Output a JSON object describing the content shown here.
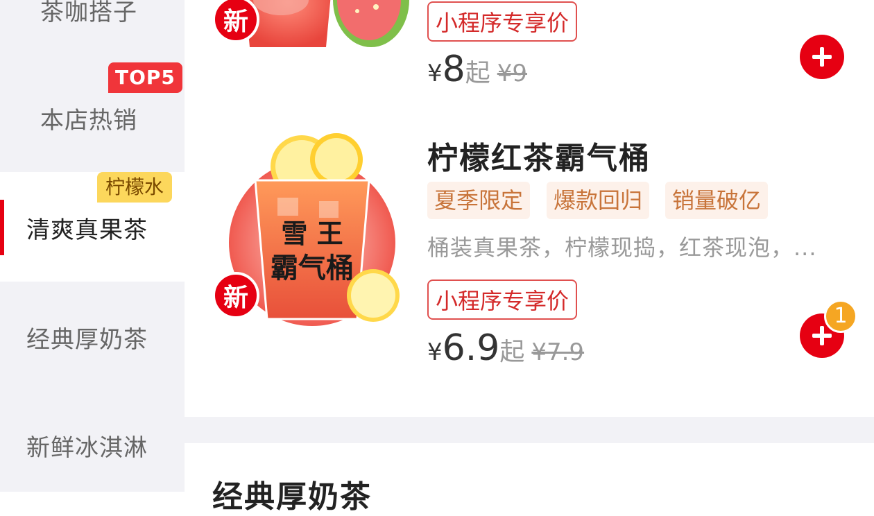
{
  "sidebar": {
    "items": [
      {
        "label": "茶咖搭子"
      },
      {
        "label": "本店热销",
        "badge": "TOP5"
      },
      {
        "label": "清爽真果茶",
        "badge": "柠檬水",
        "active": true
      },
      {
        "label": "经典厚奶茶"
      },
      {
        "label": "新鲜冰淇淋"
      }
    ]
  },
  "products": [
    {
      "new_badge": "新",
      "promo": "小程序专享价",
      "currency": "¥",
      "price": "8",
      "unit": "起",
      "original_price": "¥9"
    },
    {
      "name": "柠檬红茶霸气桶",
      "new_badge": "新",
      "tags": [
        "夏季限定",
        "爆款回归",
        "销量破亿"
      ],
      "description": "桶装真果茶，柠檬现捣，红茶现泡，...",
      "promo": "小程序专享价",
      "currency": "¥",
      "price": "6.9",
      "unit": "起",
      "original_price": "¥7.9",
      "cart_count": "1"
    }
  ],
  "next_section": {
    "title": "经典厚奶茶"
  },
  "colors": {
    "accent": "#e60012",
    "tag_bg": "#fdf1ea",
    "tag_text": "#c8743a",
    "badge_yellow": "#fcd75c"
  },
  "icons": {
    "add": "plus-icon"
  }
}
